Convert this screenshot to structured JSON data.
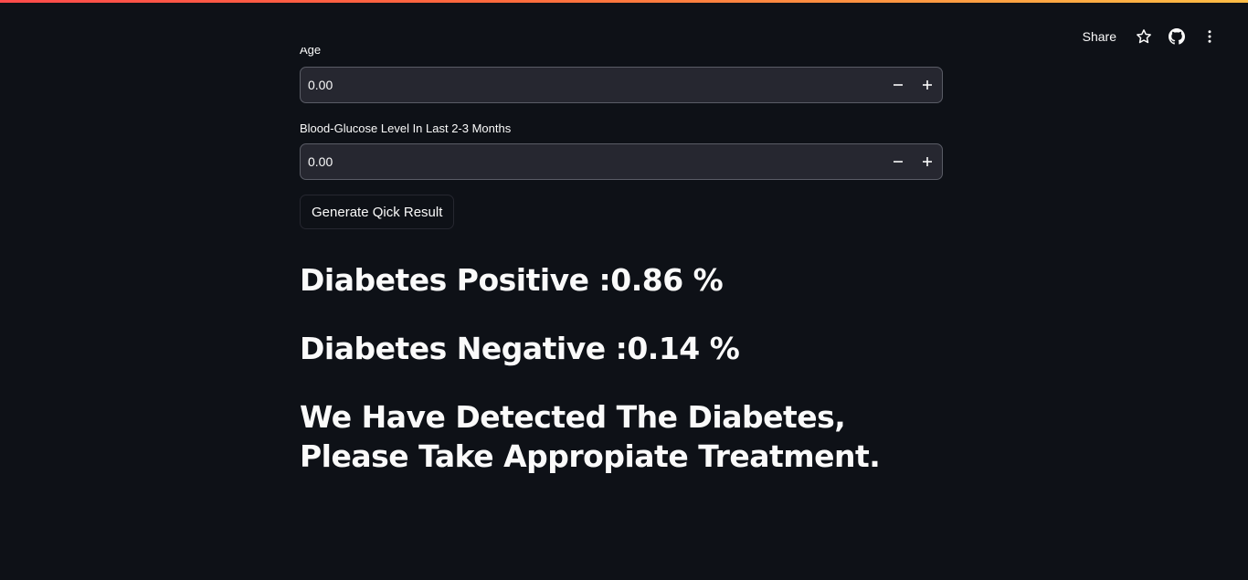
{
  "header": {
    "share_label": "Share",
    "icons": [
      "star-icon",
      "github-icon",
      "kebab-menu-icon"
    ]
  },
  "form": {
    "first_field": {
      "label": "Age",
      "value": "0.00"
    },
    "second_field": {
      "label": "Blood-Glucose Level In Last 2-3 Months",
      "value": "0.00"
    },
    "submit_label": "Generate Qick Result"
  },
  "results": {
    "positive": "Diabetes Positive :0.86 %",
    "negative": "Diabetes Negative :0.14 %",
    "message": "We Have Detected The Diabetes, Please Take Appropiate Treatment."
  },
  "colors": {
    "background": "#0e1117",
    "input_bg": "#262730",
    "text": "#fafafa",
    "accent_line": "#ff4b4b"
  }
}
